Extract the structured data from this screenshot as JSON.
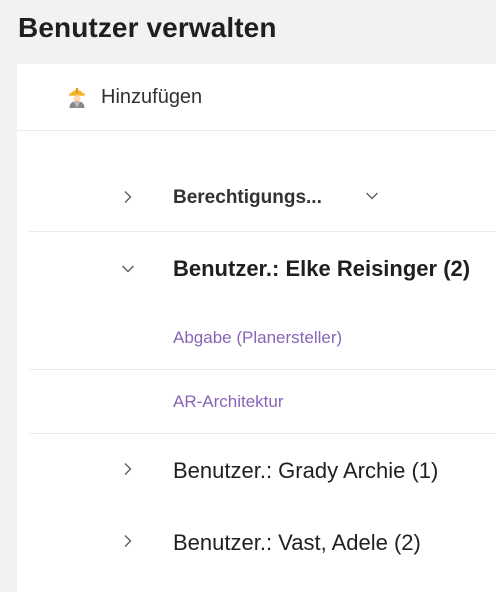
{
  "page": {
    "title": "Benutzer verwalten"
  },
  "toolbar": {
    "add_label": "Hinzufügen",
    "add_icon": "construction-worker-icon"
  },
  "column": {
    "label": "Berechtigungs...",
    "sort_icon": "chevron-down-icon"
  },
  "groups": [
    {
      "label": "Benutzer.: Elke Reisinger (2)",
      "expanded": true,
      "items": [
        "Abgabe (Planersteller)",
        "AR-Architektur"
      ]
    },
    {
      "label": "Benutzer.: Grady Archie (1)",
      "expanded": false
    },
    {
      "label": "Benutzer.: Vast, Adele (2)",
      "expanded": false
    }
  ],
  "colors": {
    "link": "#8764b8",
    "divider": "#edebe9",
    "background": "#f3f2f1"
  }
}
